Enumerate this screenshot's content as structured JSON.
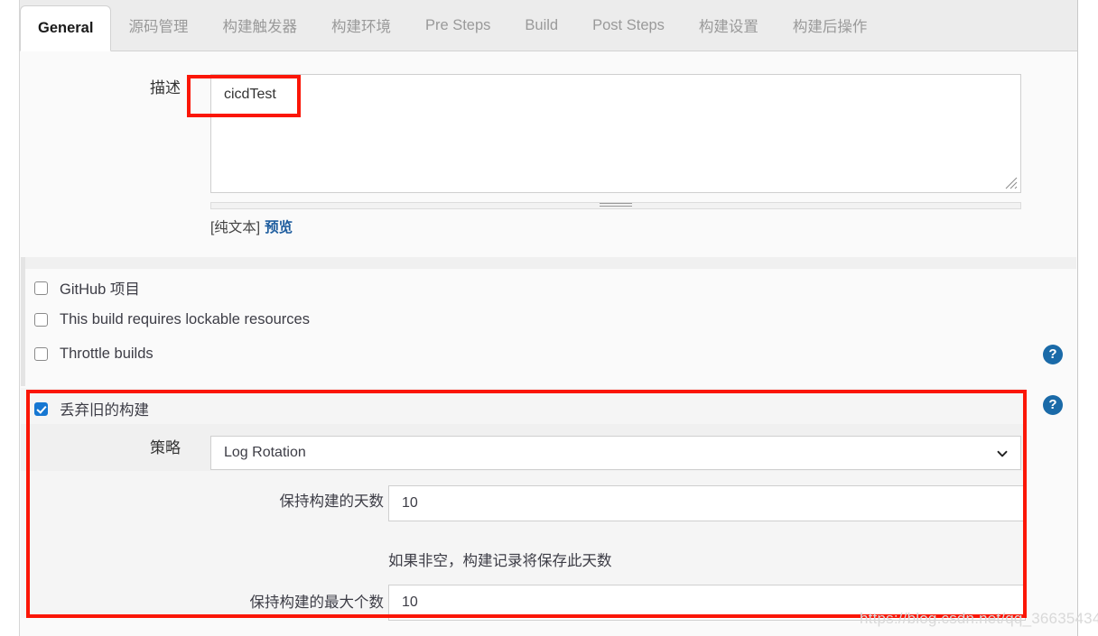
{
  "tabs": [
    {
      "label": "General",
      "active": true
    },
    {
      "label": "源码管理",
      "active": false
    },
    {
      "label": "构建触发器",
      "active": false
    },
    {
      "label": "构建环境",
      "active": false
    },
    {
      "label": "Pre Steps",
      "active": false
    },
    {
      "label": "Build",
      "active": false
    },
    {
      "label": "Post Steps",
      "active": false
    },
    {
      "label": "构建设置",
      "active": false
    },
    {
      "label": "构建后操作",
      "active": false
    }
  ],
  "description": {
    "label": "描述",
    "value": "cicdTest",
    "placeholder": "",
    "plain_text_note": "[纯文本]",
    "preview_link": "预览"
  },
  "checkboxes": [
    {
      "label": "GitHub 项目",
      "checked": false
    },
    {
      "label": "This build requires lockable resources",
      "checked": false
    },
    {
      "label": "Throttle builds",
      "checked": false
    }
  ],
  "discard": {
    "checkbox_label": "丢弃旧的构建",
    "checked": true,
    "strategy_label": "策略",
    "strategy_value": "Log Rotation",
    "days_label": "保持构建的天数",
    "days_value": "10",
    "days_helper": "如果非空，构建记录将保存此天数",
    "max_label": "保持构建的最大个数",
    "max_value": "10"
  },
  "help_icons": {
    "glyph": "?",
    "name": "help-icon",
    "color": "#1a6aa8"
  },
  "watermark": "https://blog.csdn.net/qq_36635434",
  "annotation_color": "#fb1606"
}
